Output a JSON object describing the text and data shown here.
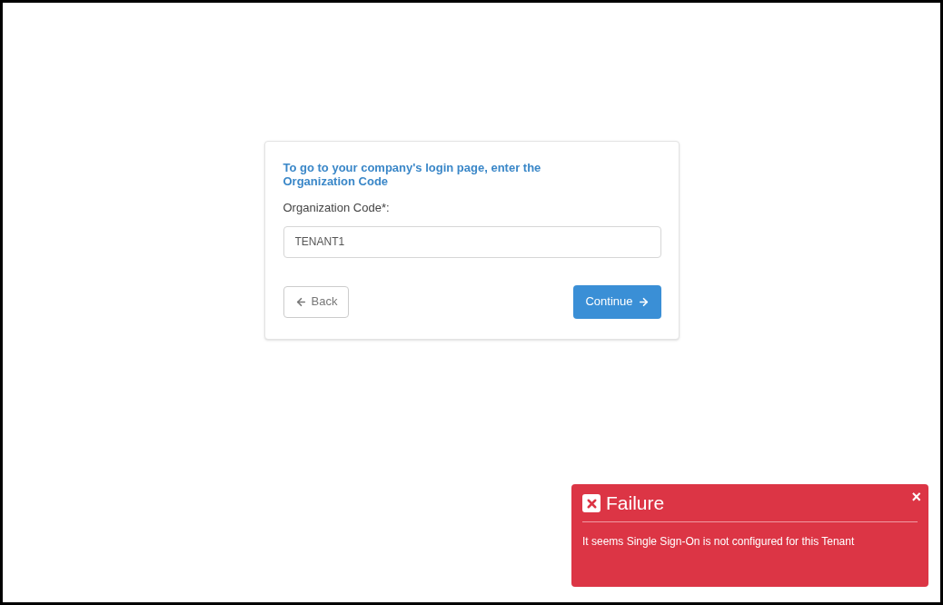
{
  "card": {
    "heading": "To go to your company's login page, enter the Organization Code",
    "field_label": "Organization Code*:",
    "field_value": "TENANT1",
    "back_button": "Back",
    "continue_button": "Continue"
  },
  "toast": {
    "title": "Failure",
    "close": "×",
    "message": "It seems Single Sign-On is not configured for this Tenant"
  }
}
